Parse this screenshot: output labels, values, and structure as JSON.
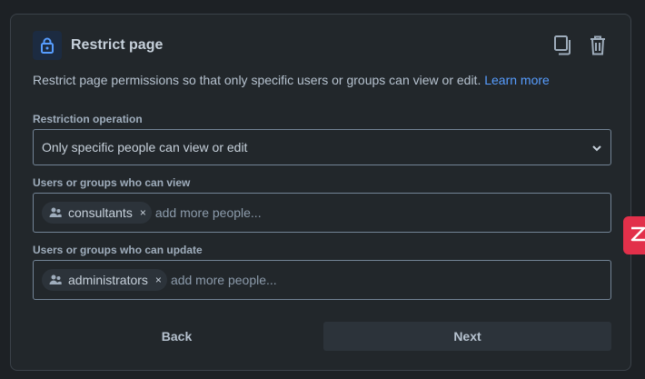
{
  "dialog": {
    "title": "Restrict page",
    "description": "Restrict page permissions so that only specific users or groups can view or edit.",
    "learn_more": "Learn more"
  },
  "restriction": {
    "label": "Restriction operation",
    "value": "Only specific people can view or edit"
  },
  "viewers": {
    "label": "Users or groups who can view",
    "chips": [
      {
        "label": "consultants"
      }
    ],
    "placeholder": "add more people..."
  },
  "updaters": {
    "label": "Users or groups who can update",
    "chips": [
      {
        "label": "administrators"
      }
    ],
    "placeholder": "add more people..."
  },
  "buttons": {
    "back": "Back",
    "next": "Next"
  },
  "chip_remove_glyph": "×",
  "colors": {
    "background": "#1d2125",
    "card": "#22272b",
    "accent": "#579dff",
    "side_tab": "#e2304a"
  },
  "icons": [
    "lock-icon",
    "copy-icon",
    "trash-icon",
    "chevron-down-icon",
    "people-icon",
    "close-icon"
  ]
}
